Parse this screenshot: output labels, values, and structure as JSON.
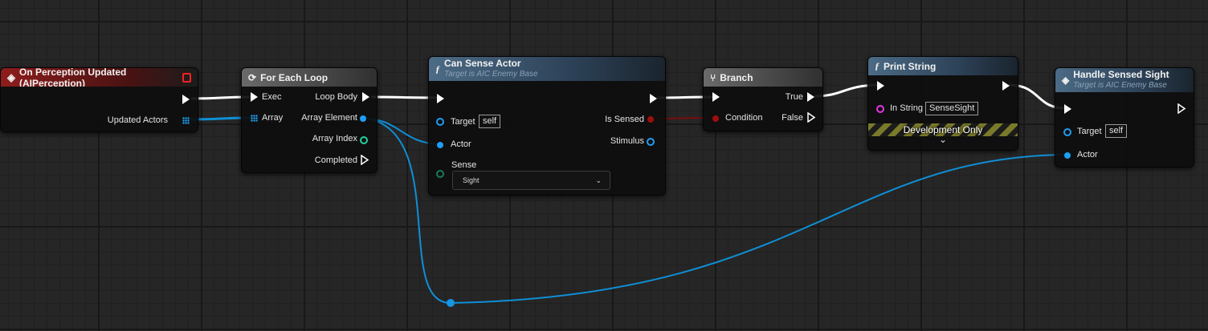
{
  "nodes": {
    "perception": {
      "title": "On Perception Updated (AIPerception)",
      "pin_updated_actors": "Updated Actors"
    },
    "foreach": {
      "title": "For Each Loop",
      "pin_exec": "Exec",
      "pin_array": "Array",
      "pin_loop_body": "Loop Body",
      "pin_array_element": "Array Element",
      "pin_array_index": "Array Index",
      "pin_completed": "Completed"
    },
    "can_sense": {
      "title": "Can Sense Actor",
      "subtitle": "Target is AIC Enemy Base",
      "pin_target": "Target",
      "target_value": "self",
      "pin_actor": "Actor",
      "pin_sense": "Sense",
      "sense_value": "Sight",
      "pin_is_sensed": "Is Sensed",
      "pin_stimulus": "Stimulus"
    },
    "branch": {
      "title": "Branch",
      "pin_condition": "Condition",
      "pin_true": "True",
      "pin_false": "False"
    },
    "print_string": {
      "title": "Print String",
      "pin_in_string": "In String",
      "in_string_value": "SenseSight",
      "dev_label": "Development Only"
    },
    "handle_sight": {
      "title": "Handle Sensed Sight",
      "subtitle": "Target is AIC Enemy Base",
      "pin_target": "Target",
      "target_value": "self",
      "pin_actor": "Actor"
    }
  },
  "colors": {
    "exec_wire": "#ffffff",
    "object_wire": "#0f8fd6",
    "bool_wire": "#7a0d0d",
    "string_pin": "#e635e6",
    "int_pin": "#1fd59f",
    "event_header": "#8e1d1d",
    "function_header": "#4c6b86",
    "pure_function_header": "#3f5c42"
  }
}
